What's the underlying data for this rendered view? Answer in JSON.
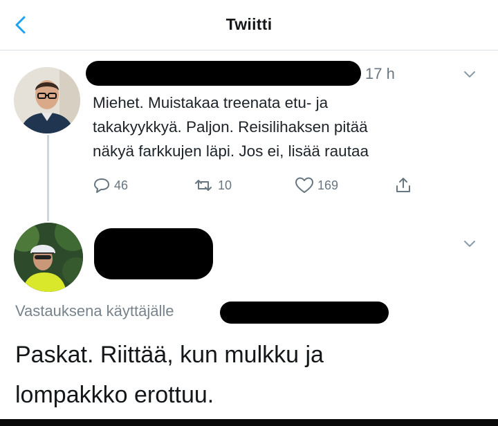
{
  "header": {
    "title": "Twiitti",
    "back_icon": "chevron-left-icon"
  },
  "tweet": {
    "author_name": "",
    "time": "17 h",
    "text": "Miehet. Muistakaa treenata etu- ja\ntakakyykkyä. Paljon. Reisilihaksen pitää\nnäkyä farkkujen läpi. Jos ei, lisää rautaa",
    "actions": {
      "replies": "46",
      "retweets": "10",
      "likes": "169"
    }
  },
  "reply": {
    "author_name": "",
    "replying_to": "Vastauksena käyttäjälle",
    "text": "Paskat. Riittää, kun mulkku ja\nlompakkko erottuu."
  },
  "colors": {
    "accent": "#1da1f2",
    "muted": "#66757f",
    "text": "#14171a"
  }
}
